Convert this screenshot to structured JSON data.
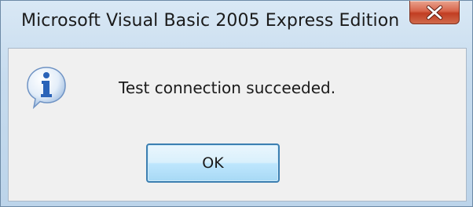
{
  "dialog": {
    "title": "Microsoft Visual Basic 2005 Express Edition",
    "message": "Test connection succeeded.",
    "icon": "information-icon",
    "close_icon": "close-icon",
    "buttons": {
      "ok_label": "OK"
    }
  },
  "colors": {
    "close_button": "#c13d22",
    "ok_button_border": "#3c7fb1",
    "info_icon": "#2a63b8",
    "client_background": "#f0f0f0"
  }
}
